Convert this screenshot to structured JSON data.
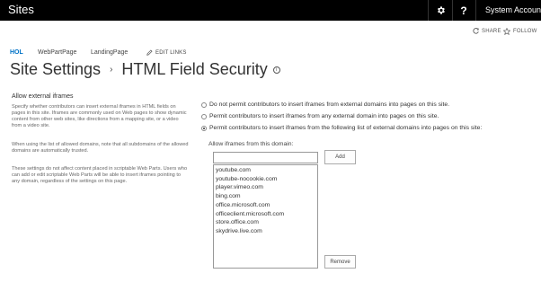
{
  "suite": {
    "title": "Sites",
    "settings_icon": "gear-icon",
    "help_label": "?",
    "user": "System Account"
  },
  "actions": {
    "share": "SHARE",
    "follow": "FOLLOW"
  },
  "nav": {
    "items": [
      "HOL",
      "WebPartPage",
      "LandingPage"
    ],
    "edit_links": "EDIT LINKS"
  },
  "page": {
    "breadcrumb_root": "Site Settings",
    "separator": "›",
    "title": "HTML Field Security",
    "info_icon": "i"
  },
  "section": {
    "title": "Allow external iframes",
    "desc1": "Specify whether contributors can insert external iframes in HTML fields on pages in this site. Iframes are commonly used on Web pages to show dynamic content from other web sites, like directions from a mapping site, or a video from a video site.",
    "desc2": "When using the list of allowed domains, note that all subdomains of the allowed domains are automatically trusted.",
    "desc3": "These settings do not affect content placed in scriptable Web Parts. Users who can add or edit scriptable Web Parts will be able to insert iframes pointing to any domain, regardless of the settings on this page."
  },
  "options": [
    {
      "label": "Do not permit contributors to insert iframes from external domains into pages on this site.",
      "checked": false
    },
    {
      "label": "Permit contributors to insert iframes from any external domain into pages on this site.",
      "checked": false
    },
    {
      "label": "Permit contributors to insert iframes from the following list of external domains into pages on this site:",
      "checked": true
    }
  ],
  "domains": {
    "label": "Allow iframes from this domain:",
    "input_value": "",
    "add_label": "Add",
    "remove_label": "Remove",
    "list": [
      "youtube.com",
      "youtube-nocookie.com",
      "player.vimeo.com",
      "bing.com",
      "office.microsoft.com",
      "officeclient.microsoft.com",
      "store.office.com",
      "skydrive.live.com"
    ]
  }
}
